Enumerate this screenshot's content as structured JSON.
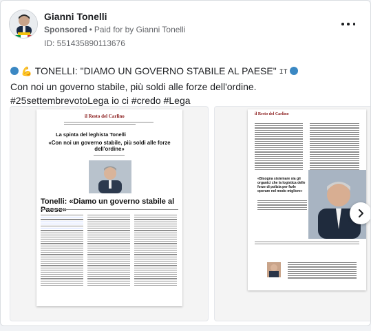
{
  "post": {
    "page_name": "Gianni Tonelli",
    "sponsored_label": "Sponsored",
    "paid_for_prefix": "Paid for by",
    "paid_for_name": "Gianni Tonelli",
    "ad_id": "ID: 551435890113676",
    "headline_text": "TONELLI: \"DIAMO UN GOVERNO STABILE AL PAESE\"",
    "flag_mark": "IT",
    "line2": "Con noi un governo stabile, più soldi alle forze dell'ordine.",
    "line3": "#25settembrevotoLega io ci #credo #Lega"
  },
  "icons": {
    "more": "more-options-icon",
    "next": "chevron-right-icon",
    "circle": "blue-circle-emoji",
    "arm": "flexed-biceps-emoji"
  },
  "colors": {
    "emoji_blue": "#3b88c3",
    "masthead_red": "#c8102e"
  },
  "carousel": {
    "slides": [
      {
        "masthead": "il Resto del Carlino",
        "kicker": "La spinta del leghista Tonelli",
        "subhead": "«Con noi un governo stabile, più soldi alle forze dell'ordine»",
        "main_headline": "Tonelli: «Diamo un governo stabile al Paese»"
      },
      {
        "masthead": "il Resto del Carlino",
        "pull_quote": "«Bisogna sistemare sia gli organici che la logistica delle forze di polizia per farle operare nel modo migliore»"
      }
    ]
  }
}
